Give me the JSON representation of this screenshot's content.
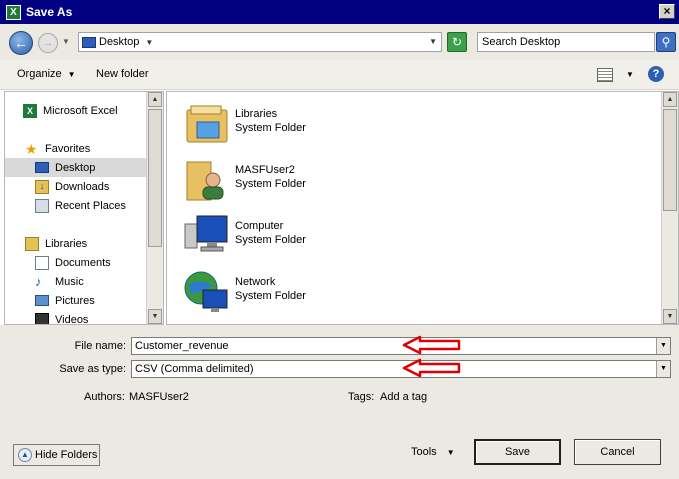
{
  "window": {
    "title": "Save As",
    "close_glyph": "×"
  },
  "nav": {
    "back_glyph": "←",
    "forward_glyph": "→"
  },
  "address": {
    "location": "Desktop",
    "refresh_glyph": "↻"
  },
  "search": {
    "placeholder": "Search Desktop",
    "button_glyph": "⚲"
  },
  "toolbar": {
    "organize": "Organize",
    "new_folder": "New folder",
    "help_glyph": "?"
  },
  "sidebar": {
    "items": [
      {
        "label": "Microsoft Excel",
        "icon": "excel-icon"
      },
      {
        "label": "Favorites",
        "icon": "star-icon"
      },
      {
        "label": "Desktop",
        "icon": "desktop-icon",
        "selected": true
      },
      {
        "label": "Downloads",
        "icon": "downloads-icon"
      },
      {
        "label": "Recent Places",
        "icon": "recent-places-icon"
      },
      {
        "label": "Libraries",
        "icon": "libraries-icon"
      },
      {
        "label": "Documents",
        "icon": "documents-icon"
      },
      {
        "label": "Music",
        "icon": "music-icon"
      },
      {
        "label": "Pictures",
        "icon": "pictures-icon"
      },
      {
        "label": "Videos",
        "icon": "videos-icon"
      }
    ]
  },
  "files": [
    {
      "name": "Libraries",
      "type": "System Folder",
      "icon": "libraries-folder-icon"
    },
    {
      "name": "MASFUser2",
      "type": "System Folder",
      "icon": "user-folder-icon"
    },
    {
      "name": "Computer",
      "type": "System Folder",
      "icon": "computer-icon"
    },
    {
      "name": "Network",
      "type": "System Folder",
      "icon": "network-icon"
    }
  ],
  "form": {
    "file_name_label": "File name:",
    "file_name_value": "Customer_revenue",
    "save_type_label": "Save as type:",
    "save_type_value": "CSV (Comma delimited)",
    "authors_label": "Authors:",
    "authors_value": "MASFUser2",
    "tags_label": "Tags:",
    "tags_value": "Add a tag"
  },
  "footer": {
    "hide_folders": "Hide Folders",
    "tools": "Tools",
    "save": "Save",
    "cancel": "Cancel"
  },
  "colors": {
    "annotation_arrow": "#e00000",
    "titlebar": "#000080"
  }
}
